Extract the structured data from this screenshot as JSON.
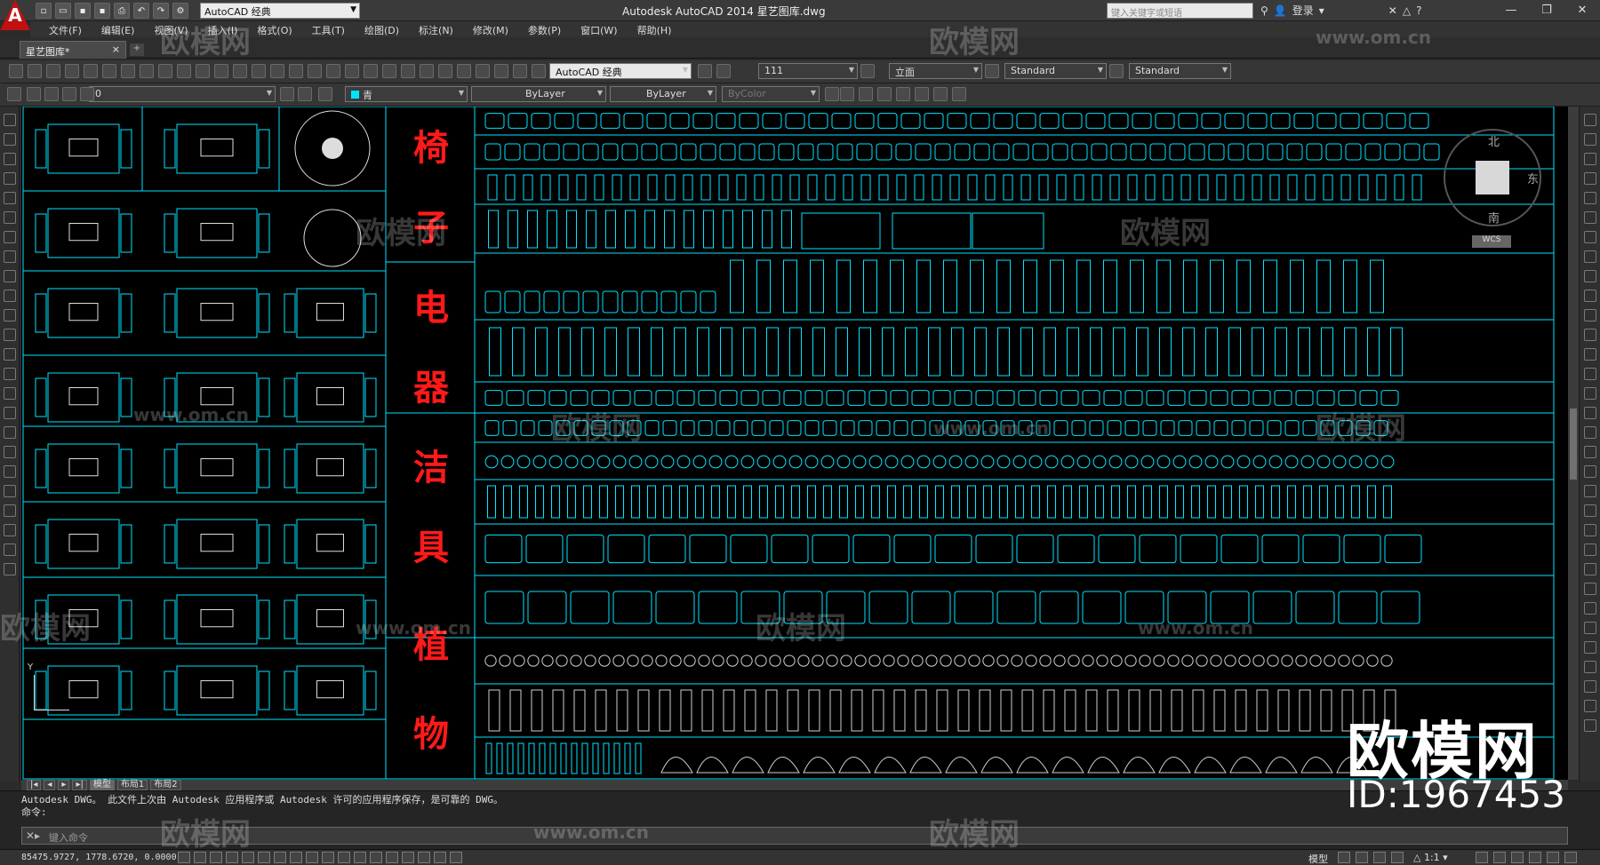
{
  "titlebar": {
    "app_logo": "A",
    "workspace": "AutoCAD 经典",
    "title": "Autodesk AutoCAD 2014    星艺图库.dwg",
    "search_placeholder": "键入关键字或短语",
    "login": "登录"
  },
  "menu": [
    "文件(F)",
    "编辑(E)",
    "视图(V)",
    "插入(I)",
    "格式(O)",
    "工具(T)",
    "绘图(D)",
    "标注(N)",
    "修改(M)",
    "参数(P)",
    "窗口(W)",
    "帮助(H)"
  ],
  "doc_tab": {
    "label": "星艺图库*",
    "close": "×"
  },
  "toolbar1": {
    "textstyle": "AutoCAD 经典",
    "annot_value": "111",
    "dimstyle": "立面",
    "tablestyle": "Standard",
    "mleaderstyle": "Standard"
  },
  "toolbar2": {
    "layer": "0",
    "color": "青",
    "linetype": "ByLayer",
    "lineweight": "ByLayer",
    "plotstyle": "ByColor"
  },
  "canvas": {
    "labels": [
      "椅",
      "子",
      "电",
      "器",
      "洁",
      "具",
      "植",
      "物"
    ],
    "viewcube": {
      "north": "北",
      "east": "东",
      "south": "南",
      "wcs": "WCS"
    },
    "ucs": "Y"
  },
  "layout_tabs": [
    "模型",
    "布局1",
    "布局2"
  ],
  "command": {
    "history": "Autodesk DWG。  此文件上次由 Autodesk 应用程序或 Autodesk 许可的应用程序保存，是可靠的 DWG。",
    "prompt": "命令:",
    "placeholder": "键入命令"
  },
  "status": {
    "coords": "85475.9727, 1778.6720, 0.0000",
    "model": "模型",
    "scale": "1:1"
  },
  "watermark": {
    "brand": "欧模网",
    "site": "www.om.cn",
    "id": "ID:1967453"
  },
  "colors": {
    "accent": "#00e5ff",
    "label_red": "#ff1a1a",
    "background": "#000000"
  }
}
